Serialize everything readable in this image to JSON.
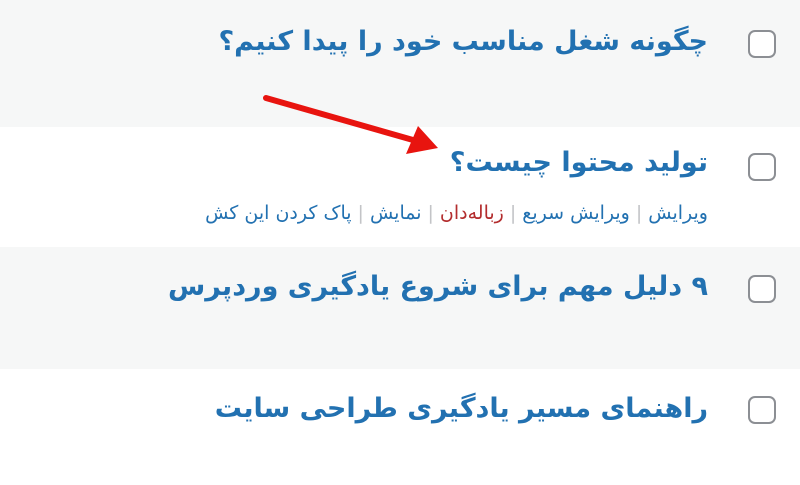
{
  "posts": [
    {
      "title": "چگونه شغل مناسب خود را پیدا کنیم؟"
    },
    {
      "title": "تولید محتوا چیست؟"
    },
    {
      "title": "۹ دلیل مهم برای شروع یادگیری وردپرس"
    },
    {
      "title": "راهنمای مسیر یادگیری طراحی سایت"
    }
  ],
  "row_actions": {
    "edit": "ویرایش",
    "quick_edit": "ویرایش سریع",
    "trash": "زباله‌دان",
    "view": "نمایش",
    "clear_cache": "پاک کردن این کش",
    "separator": "|"
  },
  "colors": {
    "link": "#2271b1",
    "trash": "#b32d2e",
    "arrow": "#e8140f",
    "row_alt": "#f6f7f7"
  },
  "icons": {
    "annotation": "red-arrow-icon"
  }
}
